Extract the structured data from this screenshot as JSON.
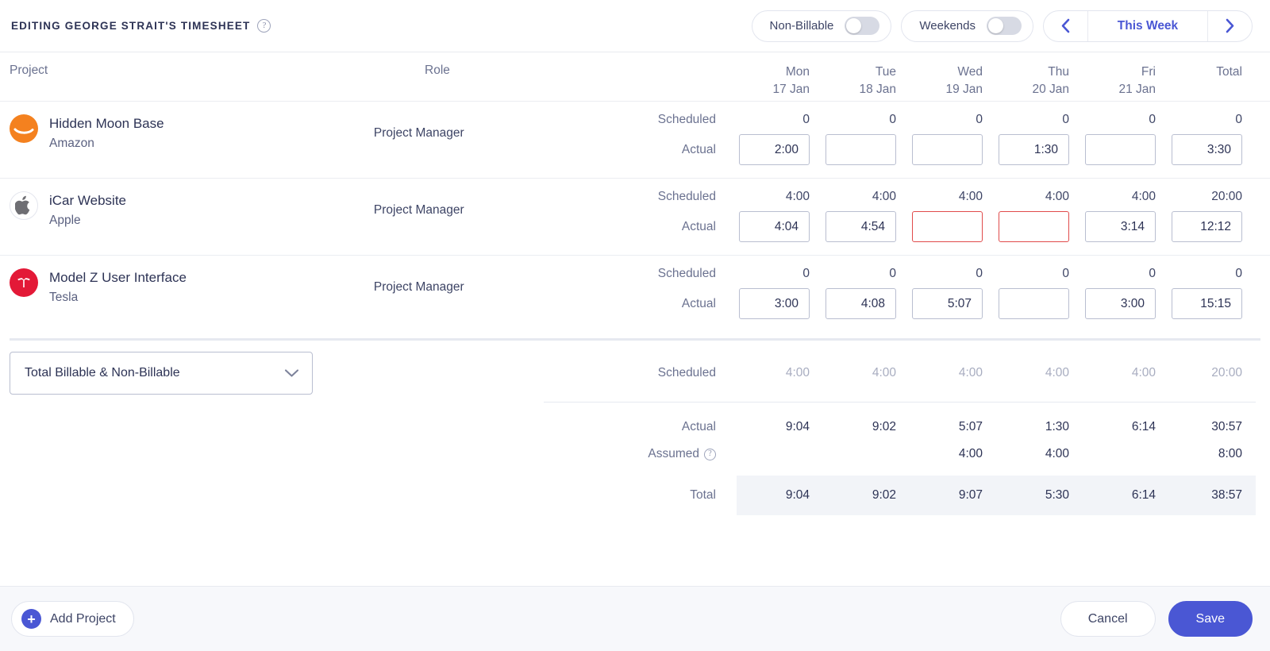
{
  "header": {
    "title": "EDITING GEORGE STRAIT'S TIMESHEET",
    "help_icon": "question-mark-icon",
    "toggles": [
      {
        "label": "Non-Billable",
        "state": "off"
      },
      {
        "label": "Weekends",
        "state": "off"
      }
    ],
    "week_nav": {
      "prev_icon": "chevron-left-icon",
      "label": "This Week",
      "next_icon": "chevron-right-icon"
    }
  },
  "table": {
    "col_project": "Project",
    "col_role": "Role",
    "days": [
      {
        "dow": "Mon",
        "date": "17 Jan"
      },
      {
        "dow": "Tue",
        "date": "18 Jan"
      },
      {
        "dow": "Wed",
        "date": "19 Jan"
      },
      {
        "dow": "Thu",
        "date": "20 Jan"
      },
      {
        "dow": "Fri",
        "date": "21 Jan"
      },
      {
        "dow": "Total",
        "date": ""
      }
    ],
    "row_labels": {
      "scheduled": "Scheduled",
      "actual": "Actual"
    },
    "projects": [
      {
        "name": "Hidden Moon Base",
        "client": "Amazon",
        "role": "Project Manager",
        "avatar": "amazon-logo-icon",
        "avatar_color": "#f4811f",
        "scheduled": [
          "0",
          "0",
          "0",
          "0",
          "0",
          "0"
        ],
        "actual": [
          "2:00",
          "",
          "",
          "1:30",
          "",
          "3:30"
        ],
        "actual_error": [
          false,
          false,
          false,
          false,
          false,
          false
        ]
      },
      {
        "name": "iCar Website",
        "client": "Apple",
        "role": "Project Manager",
        "avatar": "apple-logo-icon",
        "avatar_color": "#ffffff",
        "scheduled": [
          "4:00",
          "4:00",
          "4:00",
          "4:00",
          "4:00",
          "20:00"
        ],
        "actual": [
          "4:04",
          "4:54",
          "",
          "",
          "3:14",
          "12:12"
        ],
        "actual_error": [
          false,
          false,
          true,
          true,
          false,
          false
        ]
      },
      {
        "name": "Model Z User Interface",
        "client": "Tesla",
        "role": "Project Manager",
        "avatar": "tesla-logo-icon",
        "avatar_color": "#e31937",
        "scheduled": [
          "0",
          "0",
          "0",
          "0",
          "0",
          "0"
        ],
        "actual": [
          "3:00",
          "4:08",
          "5:07",
          "",
          "3:00",
          "15:15"
        ],
        "actual_error": [
          false,
          false,
          false,
          false,
          false,
          false
        ]
      }
    ]
  },
  "summary": {
    "dropdown": {
      "value": "Total Billable & Non-Billable",
      "icon": "chevron-down-icon"
    },
    "rows": [
      {
        "label": "Scheduled",
        "values": [
          "4:00",
          "4:00",
          "4:00",
          "4:00",
          "4:00",
          "20:00"
        ],
        "muted": true
      },
      {
        "label": "Actual",
        "values": [
          "9:04",
          "9:02",
          "5:07",
          "1:30",
          "6:14",
          "30:57"
        ],
        "muted": false
      },
      {
        "label": "Assumed",
        "values": [
          "",
          "",
          "4:00",
          "4:00",
          "",
          "8:00"
        ],
        "muted": false,
        "help_icon": "question-mark-icon"
      },
      {
        "label": "Total",
        "values": [
          "9:04",
          "9:02",
          "9:07",
          "5:30",
          "6:14",
          "38:57"
        ],
        "muted": false,
        "banded": true
      }
    ]
  },
  "footer": {
    "add_project": {
      "label": "Add Project",
      "icon": "plus-circle-icon"
    },
    "cancel": "Cancel",
    "save": "Save"
  },
  "colors": {
    "accent": "#4a57d4",
    "error": "#e04b4b",
    "text": "#2d3355",
    "muted": "#6b7290",
    "band": "#f2f4f8"
  }
}
